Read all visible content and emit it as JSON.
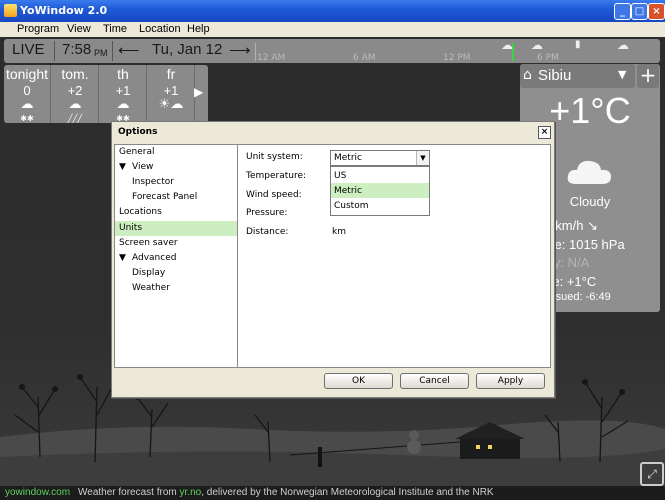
{
  "window": {
    "title": "YoWindow 2.0",
    "buttons": [
      "_",
      "□",
      "×"
    ]
  },
  "menu": [
    "Program",
    "View",
    "Time",
    "Location",
    "Help"
  ],
  "timebar": {
    "live": "LIVE",
    "time": "7:58",
    "ampm": "PM",
    "prev_icon": "arrow-left",
    "date": "Tu, Jan 12",
    "next_icon": "arrow-right"
  },
  "ruler": {
    "ticks": [
      "12 AM",
      "6 AM",
      "12 PM",
      "6 PM"
    ]
  },
  "forecast": [
    {
      "day": "tonight",
      "temp": "0",
      "icon": "snow"
    },
    {
      "day": "tom.",
      "temp": "+2",
      "icon": "rain"
    },
    {
      "day": "th",
      "temp": "+1",
      "icon": "snow"
    },
    {
      "day": "fr",
      "temp": "+1",
      "icon": "partly-sunny"
    }
  ],
  "forecast_more_icon": "arrow-right",
  "current": {
    "city": "Sibiu",
    "add_icon": "+",
    "temp": "+1°C",
    "condition": "Cloudy",
    "wind": "d:  4 km/h ↘",
    "pressure": "ssure:  1015 hPa",
    "humidity": "nidity:  N/A",
    "feels": "s like:  +1°C",
    "issued": "ast issued:  -6:49"
  },
  "dialog": {
    "title": "Options",
    "close_label": "×",
    "tree": [
      {
        "label": "General",
        "level": 0,
        "arrow": ""
      },
      {
        "label": "View",
        "level": 0,
        "arrow": "▼"
      },
      {
        "label": "Inspector",
        "level": 1,
        "arrow": ""
      },
      {
        "label": "Forecast Panel",
        "level": 1,
        "arrow": ""
      },
      {
        "label": "Locations",
        "level": 0,
        "arrow": ""
      },
      {
        "label": "Units",
        "level": 0,
        "arrow": "",
        "selected": true
      },
      {
        "label": "Screen saver",
        "level": 0,
        "arrow": ""
      },
      {
        "label": "Advanced",
        "level": 0,
        "arrow": "▼"
      },
      {
        "label": "Display",
        "level": 1,
        "arrow": ""
      },
      {
        "label": "Weather",
        "level": 1,
        "arrow": ""
      }
    ],
    "units": {
      "unit_system_label": "Unit system:",
      "unit_system_value": "Metric",
      "options": [
        "US",
        "Metric",
        "Custom"
      ],
      "temperature_label": "Temperature:",
      "wind_label": "Wind speed:",
      "pressure_label": "Pressure:",
      "pressure_value": "hPa",
      "distance_label": "Distance:",
      "distance_value": "km"
    },
    "buttons": {
      "ok": "OK",
      "cancel": "Cancel",
      "apply": "Apply"
    }
  },
  "status": {
    "site": "yowindow.com",
    "text": "Weather forecast from ",
    "link": "yr.no",
    "rest": ", delivered by the Norwegian Meteorological Institute and the NRK"
  }
}
